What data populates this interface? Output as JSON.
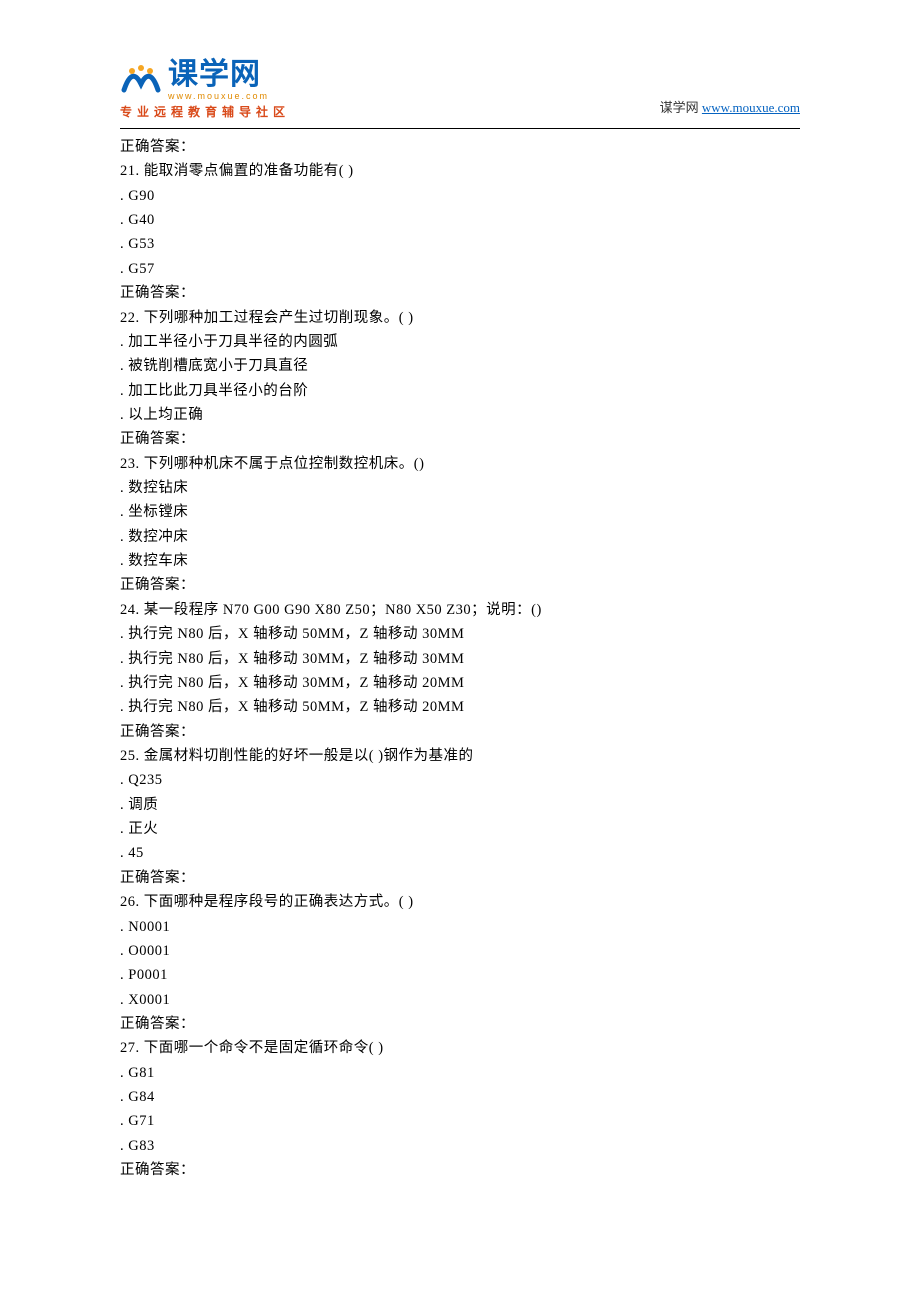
{
  "header": {
    "logo_main": "课学网",
    "logo_sub": "www.mouxue.com",
    "tagline": "专业远程教育辅导社区",
    "site_label": "谋学网",
    "site_url_text": "www.mouxue.com",
    "site_url_href": "http://www.mouxue.com"
  },
  "answer_label": "正确答案：",
  "questions": [
    {
      "num": "21.",
      "stem": "能取消零点偏置的准备功能有( )",
      "options": [
        "G90",
        "G40",
        "G53",
        "G57"
      ]
    },
    {
      "num": "22.",
      "stem": "下列哪种加工过程会产生过切削现象。( )",
      "options": [
        "加工半径小于刀具半径的内圆弧",
        "被铣削槽底宽小于刀具直径",
        "加工比此刀具半径小的台阶",
        "以上均正确"
      ]
    },
    {
      "num": "23.",
      "stem": "下列哪种机床不属于点位控制数控机床。()",
      "options": [
        "数控钻床",
        "坐标镗床",
        "数控冲床",
        "数控车床"
      ]
    },
    {
      "num": "24.",
      "stem": "某一段程序 N70 G00 G90 X80 Z50；N80 X50 Z30；说明：()",
      "options": [
        "执行完 N80 后，X 轴移动 50MM，Z 轴移动 30MM",
        "执行完 N80 后，X 轴移动 30MM，Z 轴移动 30MM",
        "执行完 N80 后，X 轴移动 30MM，Z 轴移动 20MM",
        "执行完 N80 后，X 轴移动 50MM，Z 轴移动 20MM"
      ]
    },
    {
      "num": "25.",
      "stem": "金属材料切削性能的好坏一般是以( )钢作为基准的",
      "options": [
        "Q235",
        "调质",
        "正火",
        "45"
      ]
    },
    {
      "num": "26.",
      "stem": "下面哪种是程序段号的正确表达方式。( )",
      "options": [
        "N0001",
        "O0001",
        "P0001",
        "X0001"
      ]
    },
    {
      "num": "27.",
      "stem": "下面哪一个命令不是固定循环命令( )",
      "options": [
        "G81",
        "G84",
        "G71",
        "G83"
      ]
    }
  ],
  "leading_answer": true
}
